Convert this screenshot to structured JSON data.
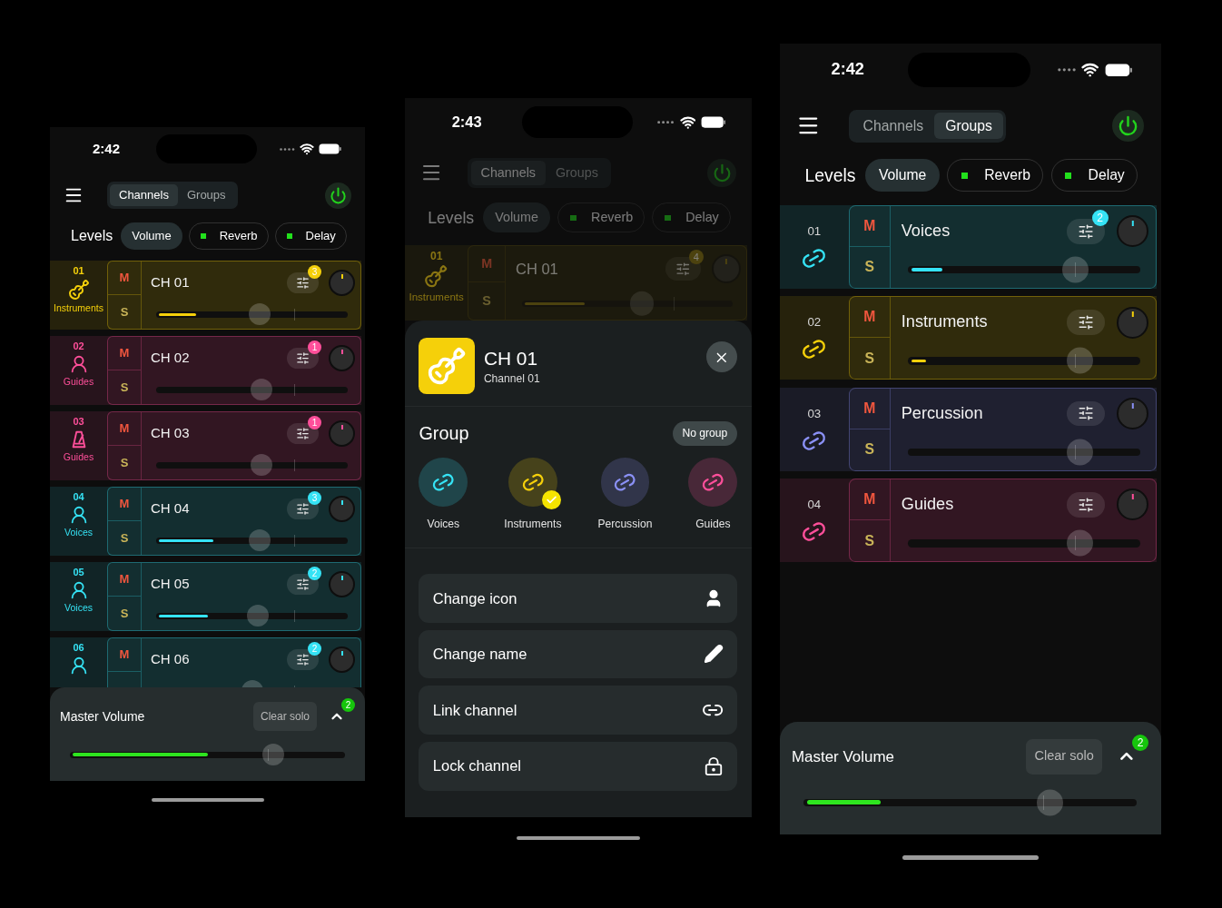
{
  "phones": [
    {
      "time": "2:42",
      "dimmed": false,
      "tabs": [
        {
          "label": "Channels",
          "selected": true
        },
        {
          "label": "Groups",
          "selected": false
        }
      ],
      "levels_label": "Levels",
      "level_tabs": [
        {
          "label": "Volume",
          "kind": "plain",
          "selected": true
        },
        {
          "label": "Reverb",
          "kind": "send",
          "selected": false
        },
        {
          "label": "Delay",
          "kind": "send",
          "selected": false
        }
      ],
      "rows": [
        {
          "number": "01",
          "kind": "guitar",
          "group": "Instruments",
          "color": "#f5d00a",
          "mute": "M",
          "solo": "S",
          "name": "CH 01",
          "badge": "3",
          "meter": {
            "level": 0.21
          },
          "fader": {
            "level": 0.54
          }
        },
        {
          "number": "02",
          "kind": "singer",
          "group": "Guides",
          "color": "#ff4f9a",
          "mute": "M",
          "solo": "S",
          "name": "CH 02",
          "badge": "1",
          "fader": {
            "level": 0.55
          }
        },
        {
          "number": "03",
          "kind": "metronome",
          "group": "Guides",
          "color": "#ff4f9a",
          "mute": "M",
          "solo": "S",
          "name": "CH 03",
          "badge": "1",
          "fader": {
            "level": 0.55
          }
        },
        {
          "number": "04",
          "kind": "singer",
          "group": "Voices",
          "color": "#35e3f5",
          "mute": "M",
          "solo": "S",
          "name": "CH 04",
          "badge": "3",
          "meter": {
            "level": 0.3
          },
          "fader": {
            "level": 0.54
          }
        },
        {
          "number": "05",
          "kind": "singer",
          "group": "Voices",
          "color": "#35e3f5",
          "mute": "M",
          "solo": "S",
          "name": "CH 05",
          "badge": "2",
          "meter": {
            "level": 0.27
          },
          "fader": {
            "level": 0.53
          }
        },
        {
          "number": "06",
          "kind": "singer",
          "color": "#35e3f5",
          "mute": "M",
          "name": "CH 06",
          "badge": "2",
          "fader": {
            "level": 0.5
          }
        }
      ],
      "master": {
        "label": "Master Volume",
        "button": "Clear solo",
        "badge": "2",
        "meter": {
          "level": 0.5
        },
        "fader": {
          "level": 0.74
        }
      }
    },
    {
      "time": "2:43",
      "dimmed": true,
      "tabs": [
        {
          "label": "Channels",
          "selected": true
        },
        {
          "label": "Groups",
          "selected": false
        }
      ],
      "levels_label": "Levels",
      "level_tabs": [
        {
          "label": "Volume",
          "kind": "plain",
          "selected": true
        },
        {
          "label": "Reverb",
          "kind": "send",
          "selected": false
        },
        {
          "label": "Delay",
          "kind": "send",
          "selected": false
        }
      ],
      "rows": [
        {
          "number": "01",
          "kind": "guitar",
          "group": "Instruments",
          "color": "#8a7512",
          "mute": "M",
          "solo": "S",
          "name": "CH 01",
          "badge": "4",
          "meter": {
            "level": 0.3
          },
          "fader": {
            "level": 0.57
          }
        }
      ],
      "sheet": {
        "title": "CH 01",
        "subtitle": "Channel 01",
        "group_title": "Group",
        "group_button": "No group",
        "groups": [
          {
            "label": "Voices",
            "color": "#35e3f5",
            "selected": false
          },
          {
            "label": "Instruments",
            "color": "#f5d00a",
            "selected": true
          },
          {
            "label": "Percussion",
            "color": "#8a90f5",
            "selected": false
          },
          {
            "label": "Guides",
            "color": "#ff4f9a",
            "selected": false
          }
        ],
        "actions": [
          {
            "label": "Change icon",
            "kind": "user"
          },
          {
            "label": "Change name",
            "kind": "pencil"
          },
          {
            "label": "Link channel",
            "kind": "link"
          },
          {
            "label": "Lock channel",
            "kind": "lock"
          }
        ]
      }
    },
    {
      "time": "2:42",
      "dimmed": false,
      "tabs": [
        {
          "label": "Channels",
          "selected": false
        },
        {
          "label": "Groups",
          "selected": true
        }
      ],
      "levels_label": "Levels",
      "level_tabs": [
        {
          "label": "Volume",
          "kind": "plain",
          "selected": true
        },
        {
          "label": "Reverb",
          "kind": "send",
          "selected": false
        },
        {
          "label": "Delay",
          "kind": "send",
          "selected": false
        }
      ],
      "rows": [
        {
          "number": "01",
          "kind": "link",
          "color": "#35e3f5",
          "mute": "M",
          "solo": "S",
          "name": "Voices",
          "badge": "2",
          "meter": {
            "level": 0.15
          },
          "fader": {
            "level": 0.72
          }
        },
        {
          "number": "02",
          "kind": "link",
          "color": "#f5d00a",
          "mute": "M",
          "solo": "S",
          "name": "Instruments",
          "meter": {
            "level": 0.08
          },
          "fader": {
            "level": 0.74
          }
        },
        {
          "number": "03",
          "kind": "link",
          "color": "#8a90f5",
          "mute": "M",
          "solo": "S",
          "name": "Percussion",
          "fader": {
            "level": 0.74
          }
        },
        {
          "number": "04",
          "kind": "link",
          "color": "#ff4f9a",
          "mute": "M",
          "solo": "S",
          "name": "Guides",
          "fader": {
            "level": 0.74
          }
        }
      ],
      "master": {
        "label": "Master Volume",
        "button": "Clear solo",
        "badge": "2",
        "meter": {
          "level": 0.23
        },
        "fader": {
          "level": 0.74
        }
      }
    }
  ]
}
